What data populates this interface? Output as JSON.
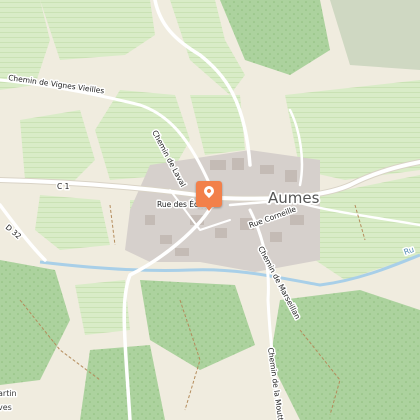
{
  "map": {
    "town": "Aumes",
    "roads": {
      "vignes_vieilles": "Chemin de Vignes Vieilles",
      "laval": "Chemin de Laval",
      "c1": "C 1",
      "d32": "D 32",
      "ecoles": "Rue des Écoles",
      "corneille": "Rue Corneille",
      "marseillan": "Chemin de Marseillan",
      "moutte": "Chemin de la Moutte"
    },
    "water_label": "Ru",
    "edge_label_top": "artin",
    "edge_label_bottom": "ves",
    "marker_icon": "map-pin-icon",
    "colors": {
      "background": "#f0ecdf",
      "vineyard": "#d9ecc7",
      "forest": "#acd29e",
      "water": "#a8cfe8",
      "roads": "#ffffff",
      "buildings": "#d6d0cc",
      "marker": "#f2804a"
    }
  }
}
